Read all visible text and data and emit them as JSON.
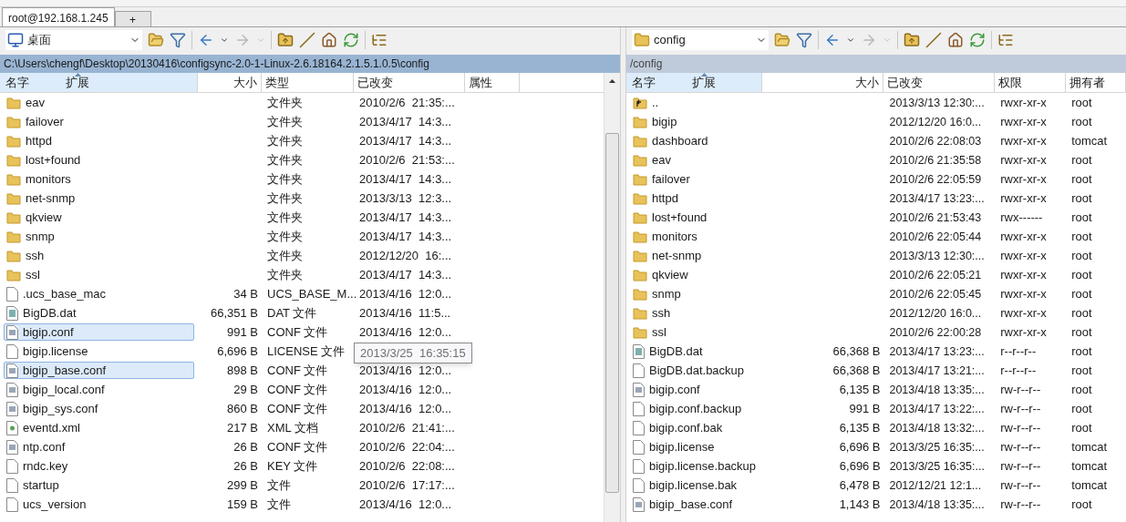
{
  "tabs": [
    {
      "label": "root@192.168.1.245",
      "selected": true
    },
    {
      "label": "+",
      "selected": false
    }
  ],
  "left_panel": {
    "location": {
      "label": "桌面",
      "kind": "desktop"
    },
    "path": "C:\\Users\\chengf\\Desktop\\20130416\\configsync-2.0-1-Linux-2.6.18164.2.1.5.1.0.5\\config",
    "columns": [
      {
        "label": "名字",
        "sorted": false
      },
      {
        "label": "扩展",
        "sorted": true
      },
      {
        "label": "大小",
        "sorted": false
      },
      {
        "label": "类型",
        "sorted": false
      },
      {
        "label": "已改变",
        "sorted": false
      },
      {
        "label": "属性",
        "sorted": false
      }
    ],
    "rows": [
      {
        "name": "eav",
        "kind": "folder",
        "size": "",
        "type": "文件夹",
        "modified": "2010/2/6  21:35:...",
        "selected": false
      },
      {
        "name": "failover",
        "kind": "folder",
        "size": "",
        "type": "文件夹",
        "modified": "2013/4/17  14:3...",
        "selected": false
      },
      {
        "name": "httpd",
        "kind": "folder",
        "size": "",
        "type": "文件夹",
        "modified": "2013/4/17  14:3...",
        "selected": false
      },
      {
        "name": "lost+found",
        "kind": "folder",
        "size": "",
        "type": "文件夹",
        "modified": "2010/2/6  21:53:...",
        "selected": false
      },
      {
        "name": "monitors",
        "kind": "folder",
        "size": "",
        "type": "文件夹",
        "modified": "2013/4/17  14:3...",
        "selected": false
      },
      {
        "name": "net-snmp",
        "kind": "folder",
        "size": "",
        "type": "文件夹",
        "modified": "2013/3/13  12:3...",
        "selected": false
      },
      {
        "name": "qkview",
        "kind": "folder",
        "size": "",
        "type": "文件夹",
        "modified": "2013/4/17  14:3...",
        "selected": false
      },
      {
        "name": "snmp",
        "kind": "folder",
        "size": "",
        "type": "文件夹",
        "modified": "2013/4/17  14:3...",
        "selected": false
      },
      {
        "name": "ssh",
        "kind": "folder",
        "size": "",
        "type": "文件夹",
        "modified": "2012/12/20  16:...",
        "selected": false
      },
      {
        "name": "ssl",
        "kind": "folder",
        "size": "",
        "type": "文件夹",
        "modified": "2013/4/17  14:3...",
        "selected": false
      },
      {
        "name": ".ucs_base_mac",
        "kind": "file",
        "size": "34 B",
        "type": "UCS_BASE_M...",
        "modified": "2013/4/16  12:0...",
        "selected": false
      },
      {
        "name": "BigDB.dat",
        "kind": "dat",
        "size": "66,351 B",
        "type": "DAT 文件",
        "modified": "2013/4/16  11:5...",
        "selected": false
      },
      {
        "name": "bigip.conf",
        "kind": "conf",
        "size": "991 B",
        "type": "CONF 文件",
        "modified": "2013/4/16  12:0...",
        "selected": true
      },
      {
        "name": "bigip.license",
        "kind": "file",
        "size": "6,696 B",
        "type": "LICENSE 文件",
        "modified_tooltip": "2013/3/25  16:35:15",
        "selected": false
      },
      {
        "name": "bigip_base.conf",
        "kind": "conf",
        "size": "898 B",
        "type": "CONF 文件",
        "modified": "2013/4/16  12:0...",
        "selected": true
      },
      {
        "name": "bigip_local.conf",
        "kind": "conf",
        "size": "29 B",
        "type": "CONF 文件",
        "modified": "2013/4/16  12:0...",
        "selected": false
      },
      {
        "name": "bigip_sys.conf",
        "kind": "conf",
        "size": "860 B",
        "type": "CONF 文件",
        "modified": "2013/4/16  12:0...",
        "selected": false
      },
      {
        "name": "eventd.xml",
        "kind": "xml",
        "size": "217 B",
        "type": "XML 文档",
        "modified": "2010/2/6  21:41:...",
        "selected": false
      },
      {
        "name": "ntp.conf",
        "kind": "conf",
        "size": "26 B",
        "type": "CONF 文件",
        "modified": "2010/2/6  22:04:...",
        "selected": false
      },
      {
        "name": "rndc.key",
        "kind": "file",
        "size": "26 B",
        "type": "KEY 文件",
        "modified": "2010/2/6  22:08:...",
        "selected": false
      },
      {
        "name": "startup",
        "kind": "file",
        "size": "299 B",
        "type": "文件",
        "modified": "2010/2/6  17:17:...",
        "selected": false
      },
      {
        "name": "ucs_version",
        "kind": "file",
        "size": "159 B",
        "type": "文件",
        "modified": "2013/4/16  12:0...",
        "selected": false
      }
    ]
  },
  "right_panel": {
    "location": {
      "label": "config",
      "kind": "folder"
    },
    "path": "/config",
    "columns": [
      {
        "label": "名字",
        "sorted": false
      },
      {
        "label": "扩展",
        "sorted": true
      },
      {
        "label": "大小",
        "sorted": false
      },
      {
        "label": "已改变",
        "sorted": false
      },
      {
        "label": "权限",
        "sorted": false
      },
      {
        "label": "拥有者",
        "sorted": false
      }
    ],
    "rows": [
      {
        "name": "..",
        "kind": "parent",
        "size": "",
        "modified": "2013/3/13 12:30:...",
        "rights": "rwxr-xr-x",
        "owner": "root",
        "selected": false
      },
      {
        "name": "bigip",
        "kind": "folder",
        "size": "",
        "modified": "2012/12/20 16:0...",
        "rights": "rwxr-xr-x",
        "owner": "root",
        "selected": false
      },
      {
        "name": "dashboard",
        "kind": "folder",
        "size": "",
        "modified": "2010/2/6 22:08:03",
        "rights": "rwxr-xr-x",
        "owner": "tomcat",
        "selected": false
      },
      {
        "name": "eav",
        "kind": "folder",
        "size": "",
        "modified": "2010/2/6 21:35:58",
        "rights": "rwxr-xr-x",
        "owner": "root",
        "selected": false
      },
      {
        "name": "failover",
        "kind": "folder",
        "size": "",
        "modified": "2010/2/6 22:05:59",
        "rights": "rwxr-xr-x",
        "owner": "root",
        "selected": false
      },
      {
        "name": "httpd",
        "kind": "folder",
        "size": "",
        "modified": "2013/4/17 13:23:...",
        "rights": "rwxr-xr-x",
        "owner": "root",
        "selected": false
      },
      {
        "name": "lost+found",
        "kind": "folder",
        "size": "",
        "modified": "2010/2/6 21:53:43",
        "rights": "rwx------",
        "owner": "root",
        "selected": false
      },
      {
        "name": "monitors",
        "kind": "folder",
        "size": "",
        "modified": "2010/2/6 22:05:44",
        "rights": "rwxr-xr-x",
        "owner": "root",
        "selected": false
      },
      {
        "name": "net-snmp",
        "kind": "folder",
        "size": "",
        "modified": "2013/3/13 12:30:...",
        "rights": "rwxr-xr-x",
        "owner": "root",
        "selected": false
      },
      {
        "name": "qkview",
        "kind": "folder",
        "size": "",
        "modified": "2010/2/6 22:05:21",
        "rights": "rwxr-xr-x",
        "owner": "root",
        "selected": false
      },
      {
        "name": "snmp",
        "kind": "folder",
        "size": "",
        "modified": "2010/2/6 22:05:45",
        "rights": "rwxr-xr-x",
        "owner": "root",
        "selected": false
      },
      {
        "name": "ssh",
        "kind": "folder",
        "size": "",
        "modified": "2012/12/20 16:0...",
        "rights": "rwxr-xr-x",
        "owner": "root",
        "selected": false
      },
      {
        "name": "ssl",
        "kind": "folder",
        "size": "",
        "modified": "2010/2/6 22:00:28",
        "rights": "rwxr-xr-x",
        "owner": "root",
        "selected": false
      },
      {
        "name": "BigDB.dat",
        "kind": "dat",
        "size": "66,368 B",
        "modified": "2013/4/17 13:23:...",
        "rights": "r--r--r--",
        "owner": "root",
        "selected": false
      },
      {
        "name": "BigDB.dat.backup",
        "kind": "file",
        "size": "66,368 B",
        "modified": "2013/4/17 13:21:...",
        "rights": "r--r--r--",
        "owner": "root",
        "selected": false
      },
      {
        "name": "bigip.conf",
        "kind": "conf",
        "size": "6,135 B",
        "modified": "2013/4/18 13:35:...",
        "rights": "rw-r--r--",
        "owner": "root",
        "selected": false
      },
      {
        "name": "bigip.conf.backup",
        "kind": "file",
        "size": "991 B",
        "modified": "2013/4/17 13:22:...",
        "rights": "rw-r--r--",
        "owner": "root",
        "selected": false
      },
      {
        "name": "bigip.conf.bak",
        "kind": "file",
        "size": "6,135 B",
        "modified": "2013/4/18 13:32:...",
        "rights": "rw-r--r--",
        "owner": "root",
        "selected": false
      },
      {
        "name": "bigip.license",
        "kind": "file",
        "size": "6,696 B",
        "modified": "2013/3/25 16:35:...",
        "rights": "rw-r--r--",
        "owner": "tomcat",
        "selected": false
      },
      {
        "name": "bigip.license.backup",
        "kind": "file",
        "size": "6,696 B",
        "modified": "2013/3/25 16:35:...",
        "rights": "rw-r--r--",
        "owner": "tomcat",
        "selected": false
      },
      {
        "name": "bigip.license.bak",
        "kind": "file",
        "size": "6,478 B",
        "modified": "2012/12/21 12:1...",
        "rights": "rw-r--r--",
        "owner": "tomcat",
        "selected": false
      },
      {
        "name": "bigip_base.conf",
        "kind": "conf",
        "size": "1,143 B",
        "modified": "2013/4/18 13:35:...",
        "rights": "rw-r--r--",
        "owner": "root",
        "selected": false
      }
    ]
  }
}
